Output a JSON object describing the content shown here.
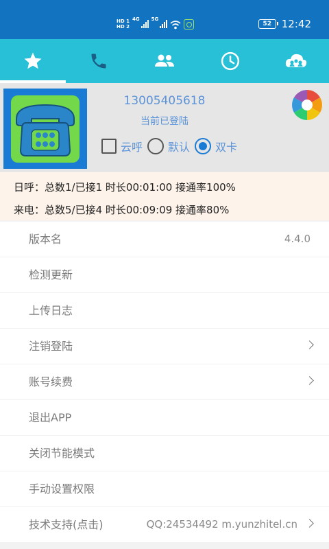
{
  "status_bar": {
    "sim1_tag": "HD 1",
    "sim2_tag": "HD 2",
    "net1": "4G",
    "net2": "5G",
    "battery": "52",
    "time": "12:42"
  },
  "tabs": [
    {
      "icon": "star-icon",
      "active": true
    },
    {
      "icon": "phone-icon",
      "active": false
    },
    {
      "icon": "contacts-icon",
      "active": false
    },
    {
      "icon": "clock-icon",
      "active": false
    },
    {
      "icon": "cloud-group-icon",
      "active": false
    }
  ],
  "profile": {
    "phone_number": "13005405618",
    "login_status": "当前已登陆",
    "options": {
      "cloud_call": "云呼",
      "default": "默认",
      "dual_sim": "双卡"
    },
    "selected_option": "双卡"
  },
  "stats": {
    "outgoing": "日呼：总数1/已接1 时长00:01:00 接通率100%",
    "incoming": "来电：总数5/已接4 时长00:09:09 接通率80%"
  },
  "menu": {
    "items": [
      {
        "label": "版本名",
        "value": "4.4.0",
        "chevron": false
      },
      {
        "label": "检测更新",
        "value": "",
        "chevron": false
      },
      {
        "label": "上传日志",
        "value": "",
        "chevron": false
      },
      {
        "label": "注销登陆",
        "value": "",
        "chevron": true
      },
      {
        "label": "账号续费",
        "value": "",
        "chevron": true
      },
      {
        "label": "退出APP",
        "value": "",
        "chevron": false
      },
      {
        "label": "关闭节能模式",
        "value": "",
        "chevron": false
      },
      {
        "label": "手动设置权限",
        "value": "",
        "chevron": false
      },
      {
        "label": "技术支持(点击)",
        "value": "QQ:24534492 m.yunzhitel.cn",
        "chevron": true
      }
    ]
  },
  "colors": {
    "status_bar": "#1274c0",
    "tab_bar": "#27c0d6",
    "accent_text": "#5b93d8",
    "avatar_bg": "#1a7bd4",
    "avatar_green": "#74d94a",
    "stats_bg": "#fdf3ea"
  }
}
